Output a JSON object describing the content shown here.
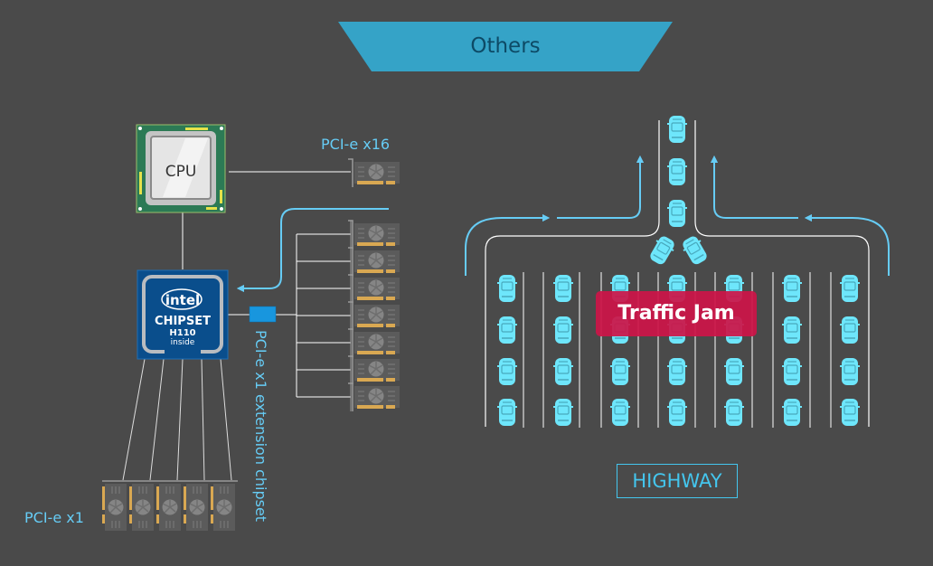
{
  "title": "Others",
  "left_diagram": {
    "cpu_label": "CPU",
    "chipset": {
      "brand": "intel",
      "line1": "CHIPSET",
      "line2": "H110",
      "line3": "inside"
    },
    "pcie_x16_label": "PCI-e x16",
    "pcie_x1_label": "PCI-e x1",
    "extension_label": "PCI-e x1 extension chipset",
    "extension_gpu_count": 7,
    "chipset_gpu_count": 5
  },
  "right_diagram": {
    "jam_label": "Traffic Jam",
    "highway_label": "HIGHWAY",
    "lanes": 7,
    "cars_per_lane": 4,
    "exit_cars": 3,
    "merging_cars": 2
  },
  "colors": {
    "background": "#4a4a4a",
    "banner": "#35a3c7",
    "accent_blue": "#66ccf5",
    "car": "#6ee6fb",
    "jam": "#cc1448",
    "intel_blue": "#0a4e8c"
  }
}
